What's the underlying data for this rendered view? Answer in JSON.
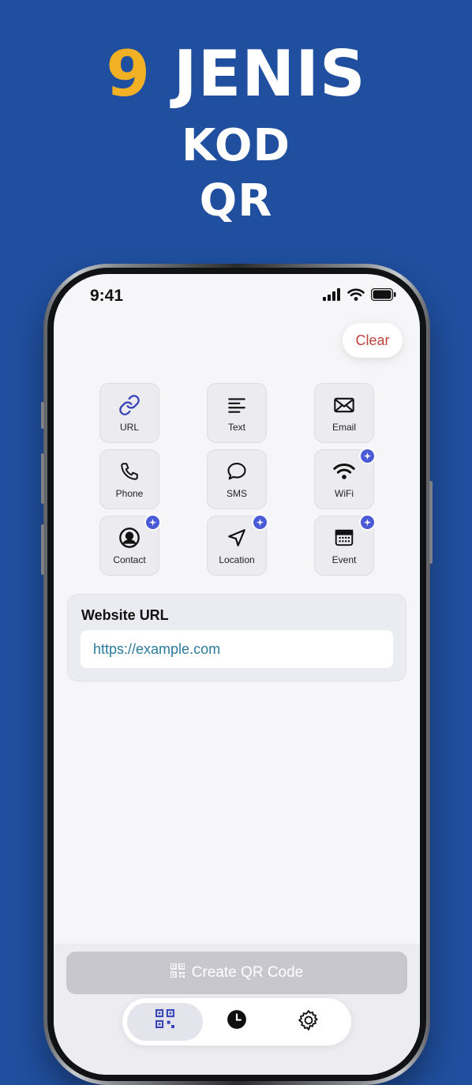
{
  "headline": {
    "number": "9",
    "word1": "JENIS",
    "line2": "KOD",
    "line3": "QR"
  },
  "status_bar": {
    "time": "9:41",
    "icons": [
      "signal-icon",
      "wifi-icon",
      "battery-icon"
    ]
  },
  "clear_label": "Clear",
  "types": [
    {
      "id": "url",
      "label": "URL",
      "icon": "link-icon",
      "selected": true,
      "pro": false
    },
    {
      "id": "text",
      "label": "Text",
      "icon": "text-lines-icon",
      "selected": false,
      "pro": false
    },
    {
      "id": "email",
      "label": "Email",
      "icon": "envelope-icon",
      "selected": false,
      "pro": false
    },
    {
      "id": "phone",
      "label": "Phone",
      "icon": "phone-icon",
      "selected": false,
      "pro": false
    },
    {
      "id": "sms",
      "label": "SMS",
      "icon": "chat-bubble-icon",
      "selected": false,
      "pro": false
    },
    {
      "id": "wifi",
      "label": "WiFi",
      "icon": "wifi-icon",
      "selected": false,
      "pro": true
    },
    {
      "id": "contact",
      "label": "Contact",
      "icon": "contact-icon",
      "selected": false,
      "pro": true
    },
    {
      "id": "location",
      "label": "Location",
      "icon": "navigation-arrow-icon",
      "selected": false,
      "pro": true
    },
    {
      "id": "event",
      "label": "Event",
      "icon": "calendar-icon",
      "selected": false,
      "pro": true
    }
  ],
  "url_form": {
    "title": "Website URL",
    "value": "https://example.com",
    "placeholder": "https://example.com"
  },
  "create_button": {
    "label": "Create QR Code",
    "icon": "qr-code-icon",
    "enabled": false
  },
  "tab_bar": {
    "tabs": [
      {
        "id": "create",
        "icon": "qr-code-icon",
        "active": true
      },
      {
        "id": "history",
        "icon": "clock-icon",
        "active": false
      },
      {
        "id": "settings",
        "icon": "gear-icon",
        "active": false
      }
    ]
  },
  "colors": {
    "background": "#204f9f",
    "accent_number": "#f2b124",
    "clear_text": "#c2423e",
    "selected_tile": "#e0e3fb",
    "badge": "#4b5bd8",
    "url_text": "#2b7a9c"
  }
}
